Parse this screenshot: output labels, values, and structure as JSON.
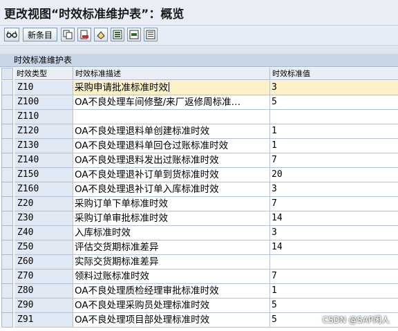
{
  "window": {
    "title": "更改视图“时效标准维护表”：概览"
  },
  "toolbar": {
    "new_entries_label": "新条目",
    "icons": [
      "glasses-icon",
      "copy-icon",
      "delete-icon",
      "undo-icon",
      "select-all-icon",
      "select-block-icon",
      "deselect-all-icon"
    ]
  },
  "table": {
    "title": "时效标准维护表",
    "columns": [
      "时效类型",
      "时效标准描述",
      "时效标准值"
    ],
    "rows": [
      {
        "type": "Z10",
        "desc": "采购申请批准标准时效",
        "value": "3"
      },
      {
        "type": "Z100",
        "desc": "OA不良处理车间修整/来厂返修周标准…",
        "value": "5"
      },
      {
        "type": "Z110",
        "desc": "",
        "value": ""
      },
      {
        "type": "Z120",
        "desc": "OA不良处理退料单创建标准时效",
        "value": "1"
      },
      {
        "type": "Z130",
        "desc": "OA不良处理退料单回仓过账标准时效",
        "value": "1"
      },
      {
        "type": "Z140",
        "desc": "OA不良处理退料发出过账标准时效",
        "value": "7"
      },
      {
        "type": "Z150",
        "desc": "OA不良处理退补订单到货标准时效",
        "value": "20"
      },
      {
        "type": "Z160",
        "desc": "OA不良处理退补订单入库标准时效",
        "value": "3"
      },
      {
        "type": "Z20",
        "desc": "采购订单下单标准时效",
        "value": "7"
      },
      {
        "type": "Z30",
        "desc": "采购订单审批标准时效",
        "value": "14"
      },
      {
        "type": "Z40",
        "desc": "入库标准时效",
        "value": "3"
      },
      {
        "type": "Z50",
        "desc": "评估交货期标准差异",
        "value": "14"
      },
      {
        "type": "Z60",
        "desc": "实际交货期标准差异",
        "value": ""
      },
      {
        "type": "Z70",
        "desc": "领料过账标准时效",
        "value": "7"
      },
      {
        "type": "Z80",
        "desc": "OA不良处理质检经理审批标准时效",
        "value": "1"
      },
      {
        "type": "Z90",
        "desc": "OA不良处理采购员处理标准时效",
        "value": "5"
      },
      {
        "type": "Z91",
        "desc": "OA不良处理项目部处理标准时效",
        "value": "5"
      }
    ]
  },
  "watermark": "CSDN @SAP闲人"
}
